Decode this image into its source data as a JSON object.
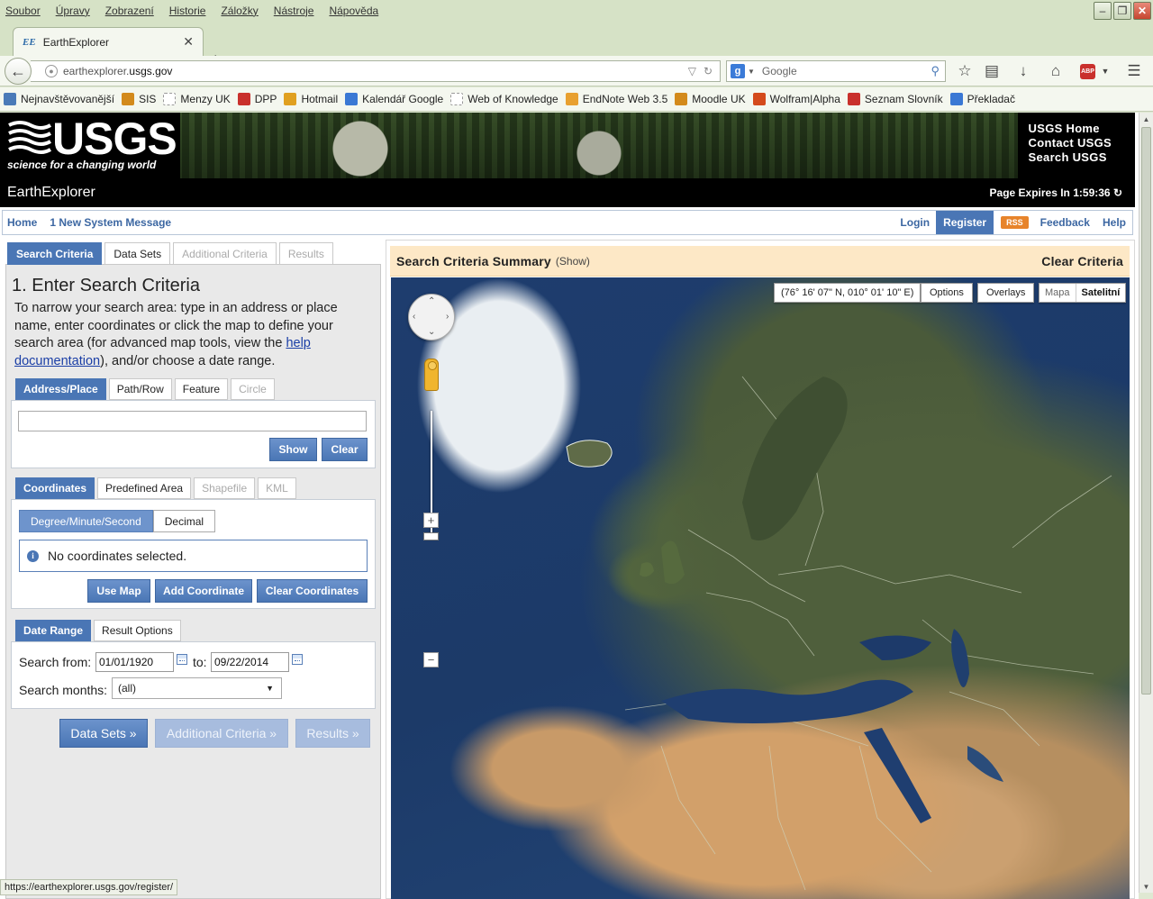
{
  "menu": [
    "Soubor",
    "Úpravy",
    "Zobrazení",
    "Historie",
    "Záložky",
    "Nástroje",
    "Nápověda"
  ],
  "tab": {
    "favicon": "EE",
    "title": "EarthExplorer"
  },
  "urlbar": {
    "host_prefix": "earthexplorer.",
    "host_domain": "usgs.gov"
  },
  "searchbar": {
    "engine": "g",
    "placeholder": "Google"
  },
  "bookmarks": [
    {
      "label": "Nejnavštěvovanější",
      "color": "#4a7ab8"
    },
    {
      "label": "SIS",
      "color": "#d38a1c"
    },
    {
      "label": "Menzy UK",
      "color": "#ffffff"
    },
    {
      "label": "DPP",
      "color": "#c9302c"
    },
    {
      "label": "Hotmail",
      "color": "#e0a020"
    },
    {
      "label": "Kalendář Google",
      "color": "#3a78d4"
    },
    {
      "label": "Web of Knowledge",
      "color": "#ffffff"
    },
    {
      "label": "EndNote Web 3.5",
      "color": "#e8a030"
    },
    {
      "label": "Moodle UK",
      "color": "#d38a1c"
    },
    {
      "label": "Wolfram|Alpha",
      "color": "#d44a1c"
    },
    {
      "label": "Seznam Slovník",
      "color": "#c9302c"
    },
    {
      "label": "Překladač",
      "color": "#3a78d4"
    }
  ],
  "header": {
    "logo_word": "USGS",
    "tagline": "science for a changing world",
    "links": [
      "USGS Home",
      "Contact USGS",
      "Search USGS"
    ],
    "app_title": "EarthExplorer",
    "expires": "Page Expires In 1:59:36"
  },
  "nav": {
    "home": "Home",
    "message": "1 New System Message",
    "login": "Login",
    "register": "Register",
    "rss": "RSS",
    "feedback": "Feedback",
    "help": "Help"
  },
  "main_tabs": [
    "Search Criteria",
    "Data Sets",
    "Additional Criteria",
    "Results"
  ],
  "step": {
    "title": "1. Enter Search Criteria",
    "intro_before": "To narrow your search area: type in an address or place name, enter coordinates or click the map to define your search area (for advanced map tools, view the ",
    "intro_link": "help documentation",
    "intro_after": "), and/or choose a date range."
  },
  "address_tabs": [
    "Address/Place",
    "Path/Row",
    "Feature",
    "Circle"
  ],
  "address": {
    "value": "",
    "show": "Show",
    "clear": "Clear"
  },
  "coord_tabs": [
    "Coordinates",
    "Predefined Area",
    "Shapefile",
    "KML"
  ],
  "coord_format": {
    "dms": "Degree/Minute/Second",
    "decimal": "Decimal"
  },
  "coords": {
    "empty": "No coordinates selected.",
    "use_map": "Use Map",
    "add": "Add Coordinate",
    "clear": "Clear Coordinates"
  },
  "date_tabs": [
    "Date Range",
    "Result Options"
  ],
  "date": {
    "from_label": "Search from:",
    "from": "01/01/1920",
    "to_label": "to:",
    "to": "09/22/2014",
    "months_label": "Search months:",
    "months": "(all)"
  },
  "next_buttons": [
    "Data Sets »",
    "Additional Criteria »",
    "Results »"
  ],
  "summary": {
    "title": "Search Criteria Summary",
    "show": "(Show)",
    "clear": "Clear Criteria"
  },
  "map": {
    "coords": "(76° 16' 07\" N, 010° 01' 10\" E)",
    "options": "Options",
    "overlays": "Overlays",
    "type_map": "Mapa",
    "type_sat": "Satelitní"
  },
  "status_url": "https://earthexplorer.usgs.gov/register/"
}
